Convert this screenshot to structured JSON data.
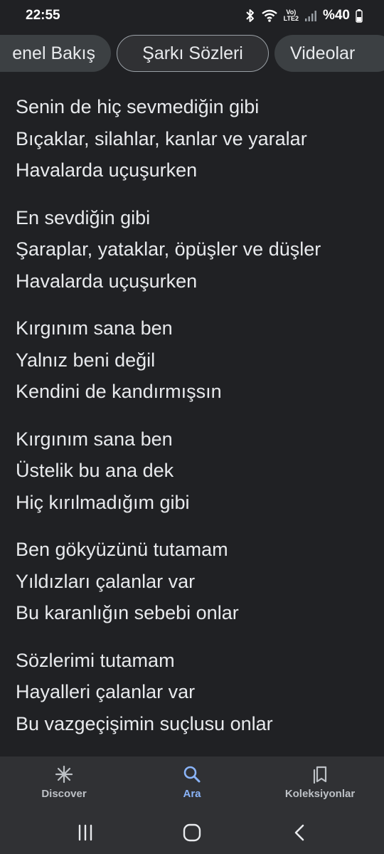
{
  "status_bar": {
    "time": "22:55",
    "network_label": "LTE2",
    "volte_label": "Vo)",
    "battery": "%40"
  },
  "tabs": [
    {
      "label": "Genel Bakış",
      "visible_label": "enel Bakış",
      "selected": false
    },
    {
      "label": "Şarkı Sözleri",
      "selected": true
    },
    {
      "label": "Videolar",
      "selected": false
    }
  ],
  "lyrics": {
    "stanzas": [
      [
        "Senin de hiç sevmediğin gibi",
        "Bıçaklar, silahlar, kanlar ve yaralar",
        "Havalarda uçuşurken"
      ],
      [
        "En sevdiğin gibi",
        "Şaraplar, yataklar, öpüşler ve düşler",
        "Havalarda uçuşurken"
      ],
      [
        "Kırgınım sana ben",
        "Yalnız beni değil",
        "Kendini de kandırmışsın"
      ],
      [
        "Kırgınım sana ben",
        "Üstelik bu ana dek",
        "Hiç kırılmadığım gibi"
      ],
      [
        "Ben gökyüzünü tutamam",
        "Yıldızları çalanlar var",
        "Bu karanlığın sebebi onlar"
      ],
      [
        "Sözlerimi tutamam",
        "Hayalleri çalanlar var",
        "Bu vazgeçişimin suçlusu onlar"
      ]
    ]
  },
  "bottom_nav": [
    {
      "label": "Discover",
      "icon": "asterisk-icon",
      "active": false
    },
    {
      "label": "Ara",
      "icon": "search-icon",
      "active": true
    },
    {
      "label": "Koleksiyonlar",
      "icon": "collections-icon",
      "active": false
    }
  ],
  "colors": {
    "background": "#202124",
    "text": "#e8eaed",
    "tab_bg": "#3c4043",
    "active_accent": "#8ab4f8",
    "nav_bg": "#303134"
  }
}
